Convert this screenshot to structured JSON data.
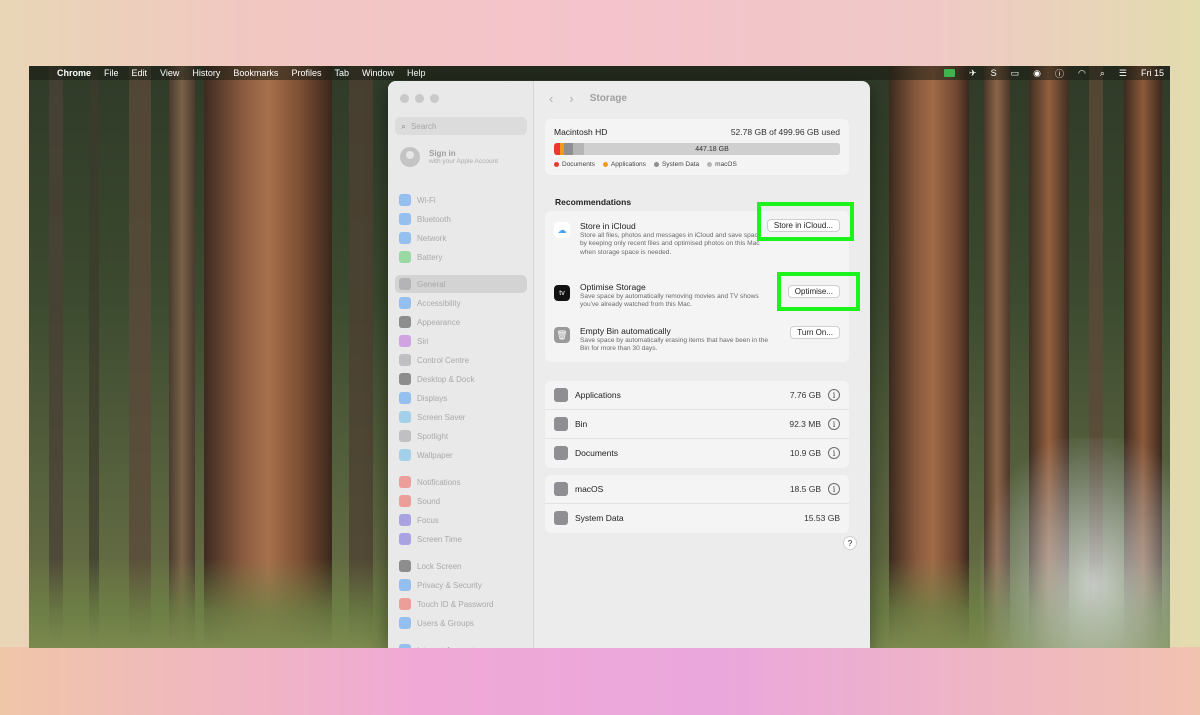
{
  "menubar": {
    "app": "Chrome",
    "items": [
      "File",
      "Edit",
      "View",
      "History",
      "Bookmarks",
      "Profiles",
      "Tab",
      "Window",
      "Help"
    ],
    "clock": "Fri 15"
  },
  "sidebar": {
    "search_placeholder": "Search",
    "signin_title": "Sign in",
    "signin_subtitle": "with your Apple Account",
    "items": [
      {
        "label": "Wi-Fi",
        "color": "#2f8cf6"
      },
      {
        "label": "Bluetooth",
        "color": "#2f8cf6"
      },
      {
        "label": "Network",
        "color": "#2f8cf6"
      },
      {
        "label": "Battery",
        "color": "#3ec34e"
      },
      {
        "label": "General",
        "color": "#8e8e93"
      },
      {
        "label": "Accessibility",
        "color": "#2f8cf6"
      },
      {
        "label": "Appearance",
        "color": "#1c1c1e"
      },
      {
        "label": "Siri",
        "color": "#b14fd8"
      },
      {
        "label": "Control Centre",
        "color": "#8e8e93"
      },
      {
        "label": "Desktop & Dock",
        "color": "#1c1c1e"
      },
      {
        "label": "Displays",
        "color": "#2f8cf6"
      },
      {
        "label": "Screen Saver",
        "color": "#4fb3e8"
      },
      {
        "label": "Spotlight",
        "color": "#8e8e93"
      },
      {
        "label": "Wallpaper",
        "color": "#4fb3e8"
      },
      {
        "label": "Notifications",
        "color": "#f0443a"
      },
      {
        "label": "Sound",
        "color": "#f0443a"
      },
      {
        "label": "Focus",
        "color": "#5b4fd8"
      },
      {
        "label": "Screen Time",
        "color": "#5b4fd8"
      },
      {
        "label": "Lock Screen",
        "color": "#1c1c1e"
      },
      {
        "label": "Privacy & Security",
        "color": "#2f8cf6"
      },
      {
        "label": "Touch ID & Password",
        "color": "#f0443a"
      },
      {
        "label": "Users & Groups",
        "color": "#2f8cf6"
      },
      {
        "label": "Internet Accounts",
        "color": "#2f8cf6"
      }
    ]
  },
  "toolbar": {
    "title": "Storage"
  },
  "disk": {
    "name": "Macintosh HD",
    "used": "52.78 GB of 499.96 GB used",
    "free_label": "447.18 GB",
    "legend": [
      {
        "label": "Documents",
        "color": "#e8392c"
      },
      {
        "label": "Applications",
        "color": "#f39a1e"
      },
      {
        "label": "System Data",
        "color": "#8e8e93"
      },
      {
        "label": "macOS",
        "color": "#b5b5b5"
      }
    ]
  },
  "recommendations": {
    "heading": "Recommendations",
    "items": [
      {
        "title": "Store in iCloud",
        "desc": "Store all files, photos and messages in iCloud and save space by keeping only recent files and optimised photos on this Mac when storage space is needed.",
        "button": "Store in iCloud..."
      },
      {
        "title": "Optimise Storage",
        "desc": "Save space by automatically removing movies and TV shows you've already watched from this Mac.",
        "button": "Optimise..."
      },
      {
        "title": "Empty Bin automatically",
        "desc": "Save space by automatically erasing items that have been in the Bin for more than 30 days.",
        "button": "Turn On..."
      }
    ]
  },
  "categories": [
    {
      "name": "Applications",
      "size": "7.76 GB",
      "info": true
    },
    {
      "name": "Bin",
      "size": "92.3 MB",
      "info": true
    },
    {
      "name": "Documents",
      "size": "10.9 GB",
      "info": true
    }
  ],
  "categories2": [
    {
      "name": "macOS",
      "size": "18.5 GB",
      "info": true
    },
    {
      "name": "System Data",
      "size": "15.53 GB",
      "info": false
    }
  ],
  "help": "?"
}
